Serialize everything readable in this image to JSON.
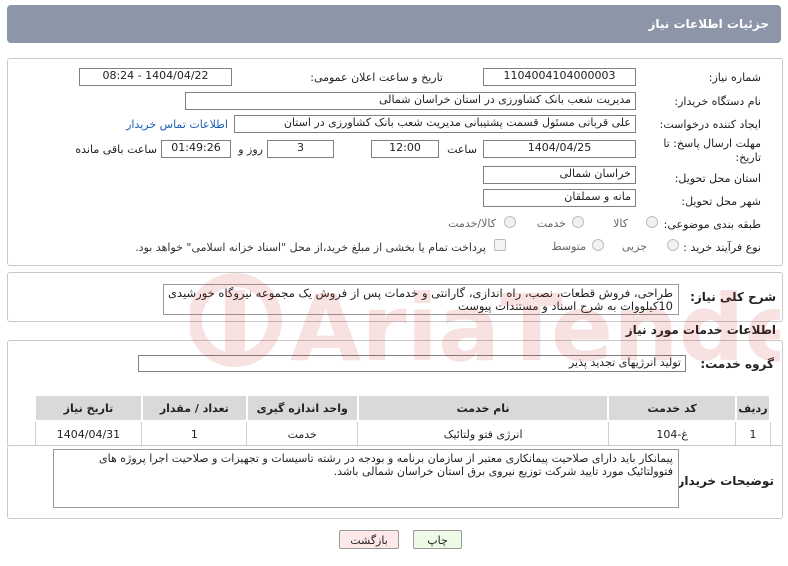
{
  "header": {
    "title": "جزئیات اطلاعات نیاز"
  },
  "form": {
    "need_number_label": "شماره نیاز:",
    "need_number": "1104004104000003",
    "announce_label": "تاریخ و ساعت اعلان عمومی:",
    "announce_value": "1404/04/22 - 08:24",
    "buyer_org_label": "نام دستگاه خریدار:",
    "buyer_org": "مدیریت شعب بانک کشاورزی در استان خراسان شمالی",
    "creator_label": "ایجاد کننده درخواست:",
    "creator": "علی  قربانی  مسئول قسمت پشتیبانی مدیریت شعب بانک کشاورزی در استان",
    "contact_link": "اطلاعات تماس خریدار",
    "deadline_label": "مهلت ارسال پاسخ: تا تاریخ:",
    "deadline_date": "1404/04/25",
    "time_label": "ساعت",
    "deadline_time": "12:00",
    "days_value": "3",
    "days_label": "روز و",
    "remaining_time": "01:49:26",
    "remaining_label": "ساعت باقی مانده",
    "province_label": "استان محل تحویل:",
    "province": "خراسان شمالی",
    "city_label": "شهر محل تحویل:",
    "city": "مانه و سملقان",
    "category_label": "طبقه بندی موضوعی:",
    "category_options": [
      "کالا",
      "خدمت",
      "کالا/خدمت"
    ],
    "category_selected": "خدمت",
    "purchase_type_label": "نوع فرآیند خرید :",
    "purchase_options": [
      "جزیی",
      "متوسط"
    ],
    "purchase_note": "پرداخت تمام یا بخشی از مبلغ خرید،از محل \"اسناد خزانه اسلامی\" خواهد بود."
  },
  "description": {
    "label": "شرح کلی نیاز:",
    "text_line1": "طراحی، فروش قطعات، نصب، راه اندازی، گارانتی و خدمات پس از فروش یک مجموعه نیروگاه خورشیدی",
    "text_line2": "10کیلووات به شرح اسناد و مستندات پیوست"
  },
  "services": {
    "section_title": "اطلاعات خدمات مورد نیاز",
    "group_label": "گروه خدمت:",
    "group_value": "تولید انرژیهای تجدید پذیر",
    "columns": [
      "ردیف",
      "کد خدمت",
      "نام خدمت",
      "واحد اندازه گیری",
      "تعداد / مقدار",
      "تاریخ نیاز"
    ],
    "rows": [
      {
        "row": "1",
        "code": "غ-104",
        "name": "انرژی فتو ولتائیک",
        "unit": "خدمت",
        "qty": "1",
        "date": "1404/04/31"
      }
    ]
  },
  "buyer_notes": {
    "label": "توضیحات خریدار:",
    "line1": "پیمانکار باید دارای صلاحیت پیمانکاری معتبر از سازمان برنامه و بودجه در رشته تاسیسات و تجهیزات و صلاحیت اجرا پروژه های",
    "line2": "فتوولتائیک مورد تایید شرکت توزیع نیروی برق استان خراسان شمالی باشد."
  },
  "buttons": {
    "print": "چاپ",
    "back": "بازگشت"
  },
  "colors": {
    "header_bg": "#8c96a8",
    "link": "#1a5fb4",
    "print_bg": "#eef9e6",
    "back_bg": "#fde8ea"
  }
}
